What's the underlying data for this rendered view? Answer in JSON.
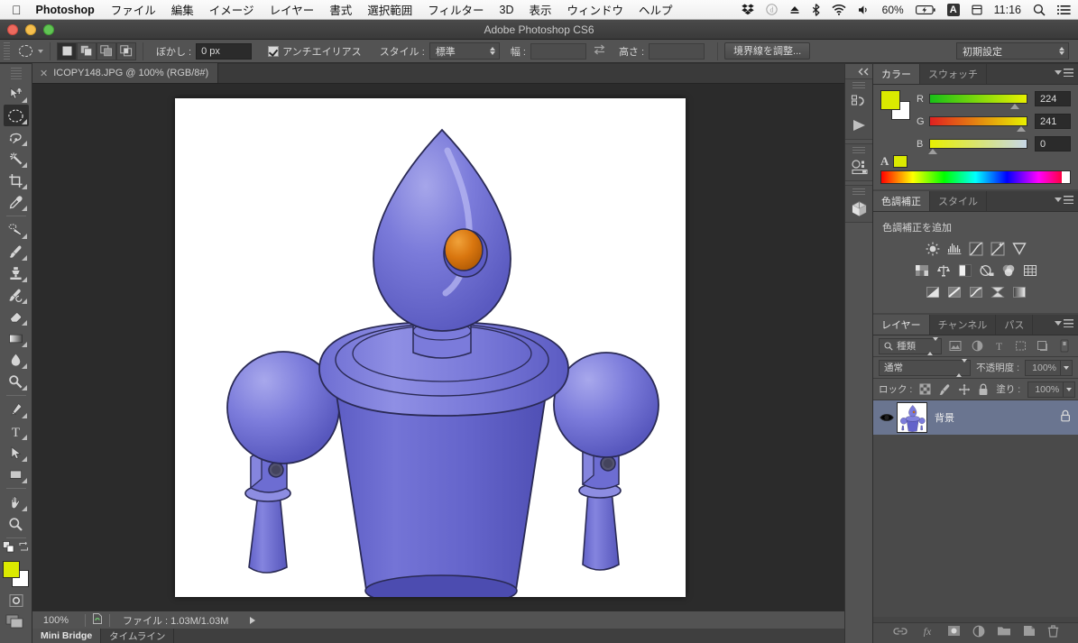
{
  "macbar": {
    "apple_icon": "apple-logo",
    "app_name": "Photoshop",
    "menus": [
      "ファイル",
      "編集",
      "イメージ",
      "レイヤー",
      "書式",
      "選択範囲",
      "フィルター",
      "3D",
      "表示",
      "ウィンドウ",
      "ヘルプ"
    ],
    "status_items": {
      "dropbox_icon": "dropbox-icon",
      "d_icon": "circle-d-icon",
      "eject_icon": "eject-icon",
      "bluetooth_icon": "bluetooth-icon",
      "wifi_icon": "wifi-icon",
      "volume_icon": "volume-icon",
      "battery_percent": "60%",
      "battery_icon": "battery-charging-icon",
      "input_source": "A",
      "calendar_icon": "calendar-icon",
      "clock": "11:16",
      "spotlight_icon": "search-icon",
      "notification_icon": "notification-center-icon"
    }
  },
  "window": {
    "title": "Adobe Photoshop CS6"
  },
  "options_bar": {
    "tool_preview_icon": "elliptical-marquee-icon",
    "selection_modes": [
      "new-selection",
      "add-to-selection",
      "subtract-from-selection",
      "intersect-selection"
    ],
    "selection_mode_active": 0,
    "feather_label": "ぼかし :",
    "feather_value": "0 px",
    "antialias_label": "アンチエイリアス",
    "antialias_checked": true,
    "style_label": "スタイル :",
    "style_value": "標準",
    "width_label": "幅 :",
    "width_value": "",
    "swap_icon": "swap-width-height-icon",
    "height_label": "高さ :",
    "height_value": "",
    "refine_edge_button": "境界線を調整...",
    "workspace_value": "初期設定"
  },
  "document_tab": {
    "close_icon": "close-icon",
    "title": "ICOPY148.JPG @ 100% (RGB/8#)"
  },
  "tools": {
    "items": [
      {
        "name": "move-tool",
        "icon": "move-icon",
        "selected": false,
        "has_flyout": true
      },
      {
        "name": "elliptical-marquee-tool",
        "icon": "ellipse-marquee-icon",
        "selected": true,
        "has_flyout": true
      },
      {
        "name": "lasso-tool",
        "icon": "lasso-icon",
        "selected": false,
        "has_flyout": true
      },
      {
        "name": "magic-wand-tool",
        "icon": "magic-wand-icon",
        "selected": false,
        "has_flyout": true
      },
      {
        "name": "crop-tool",
        "icon": "crop-icon",
        "selected": false,
        "has_flyout": true
      },
      {
        "name": "eyedropper-tool",
        "icon": "eyedropper-icon",
        "selected": false,
        "has_flyout": true
      },
      {
        "name": "spot-healing-brush-tool",
        "icon": "healing-brush-icon",
        "selected": false,
        "has_flyout": true
      },
      {
        "name": "brush-tool",
        "icon": "brush-icon",
        "selected": false,
        "has_flyout": true
      },
      {
        "name": "clone-stamp-tool",
        "icon": "clone-stamp-icon",
        "selected": false,
        "has_flyout": true
      },
      {
        "name": "history-brush-tool",
        "icon": "history-brush-icon",
        "selected": false,
        "has_flyout": true
      },
      {
        "name": "eraser-tool",
        "icon": "eraser-icon",
        "selected": false,
        "has_flyout": true
      },
      {
        "name": "gradient-tool",
        "icon": "gradient-icon",
        "selected": false,
        "has_flyout": true
      },
      {
        "name": "blur-tool",
        "icon": "blur-drop-icon",
        "selected": false,
        "has_flyout": true
      },
      {
        "name": "dodge-tool",
        "icon": "dodge-icon",
        "selected": false,
        "has_flyout": true
      },
      {
        "name": "pen-tool",
        "icon": "pen-icon",
        "selected": false,
        "has_flyout": true
      },
      {
        "name": "type-tool",
        "icon": "type-t-icon",
        "selected": false,
        "has_flyout": true
      },
      {
        "name": "path-selection-tool",
        "icon": "path-arrow-icon",
        "selected": false,
        "has_flyout": true
      },
      {
        "name": "rectangle-shape-tool",
        "icon": "rectangle-icon",
        "selected": false,
        "has_flyout": true
      },
      {
        "name": "hand-tool",
        "icon": "hand-icon",
        "selected": false,
        "has_flyout": true
      },
      {
        "name": "zoom-tool",
        "icon": "zoom-magnifier-icon",
        "selected": false,
        "has_flyout": false
      }
    ],
    "default_colors_icon": "default-colors-icon",
    "swap_colors_icon": "swap-colors-icon",
    "foreground_color": "#dbea00",
    "background_color": "#ffffff",
    "quick_mask_icon": "quick-mask-icon",
    "screen_mode_icon": "screen-mode-icon"
  },
  "dock_strip": {
    "collapse_icon": "collapse-panels-icon",
    "icons": [
      "history-icon",
      "actions-play-icon",
      "mini-bridge-icon",
      "3d-cube-icon"
    ]
  },
  "color_panel": {
    "tabs": [
      {
        "label": "カラー",
        "active": true
      },
      {
        "label": "スウォッチ",
        "active": false
      }
    ],
    "menu_icon": "panel-menu-icon",
    "foreground_color": "#dbea00",
    "background_color": "#ffffff",
    "alpha_label": "A",
    "channels": [
      {
        "label": "R",
        "value": "224",
        "pos_pct": 88
      },
      {
        "label": "G",
        "value": "241",
        "pos_pct": 94
      },
      {
        "label": "B",
        "value": "0",
        "pos_pct": 1
      }
    ]
  },
  "adjustments_panel": {
    "tabs": [
      {
        "label": "色調補正",
        "active": true
      },
      {
        "label": "スタイル",
        "active": false
      }
    ],
    "menu_icon": "panel-menu-icon",
    "title": "色調補正を追加",
    "rows": [
      [
        "brightness-contrast-icon",
        "levels-icon",
        "curves-icon",
        "exposure-icon",
        "vibrance-icon"
      ],
      [
        "hue-saturation-icon",
        "color-balance-icon",
        "black-white-icon",
        "photo-filter-icon",
        "channel-mixer-icon",
        "color-lookup-icon"
      ],
      [
        "invert-icon",
        "posterize-icon",
        "threshold-icon",
        "selective-color-icon",
        "gradient-map-icon"
      ]
    ]
  },
  "layers_panel": {
    "tabs": [
      {
        "label": "レイヤー",
        "active": true
      },
      {
        "label": "チャンネル",
        "active": false
      },
      {
        "label": "パス",
        "active": false
      }
    ],
    "menu_icon": "panel-menu-icon",
    "filter_icon": "search-icon",
    "filter_value": "種類",
    "filter_type_icons": [
      "pixel-filter-icon",
      "adjustment-filter-icon",
      "type-filter-icon",
      "shape-filter-icon",
      "smart-object-filter-icon"
    ],
    "filter_toggle_icon": "filter-power-icon",
    "blend_mode": "通常",
    "opacity_label": "不透明度 :",
    "opacity_value": "100%",
    "lock_label": "ロック :",
    "lock_icons": [
      "lock-transparent-pixels-icon",
      "lock-image-pixels-icon",
      "lock-position-icon",
      "lock-all-icon"
    ],
    "fill_label": "塗り :",
    "fill_value": "100%",
    "layers": [
      {
        "name": "背景",
        "visible": true,
        "visibility_icon": "eye-icon",
        "locked": true,
        "lock_icon": "lock-icon",
        "selected": true,
        "thumbnail": "robot-thumbnail"
      }
    ],
    "footer_icons": [
      "link-layers-icon",
      "layer-style-fx-icon",
      "add-layer-mask-icon",
      "new-adjustment-layer-icon",
      "new-group-icon",
      "new-layer-icon",
      "delete-layer-icon"
    ]
  },
  "status_bar": {
    "zoom": "100%",
    "doc_profile_icon": "document-profile-icon",
    "doc_info": "ファイル : 1.03M/1.03M",
    "expand_icon": "play-arrow-icon"
  },
  "bottom_tabs": [
    {
      "label": "Mini Bridge",
      "active": true
    },
    {
      "label": "タイムライン",
      "active": false
    }
  ],
  "canvas": {
    "background_color": "#ffffff",
    "artwork_name": "3d-robot-render",
    "body_color": "#6f6fd6",
    "body_color_dark": "#5a5ac4",
    "eye_color": "#d9760f",
    "outline_color": "#2a2a55"
  }
}
